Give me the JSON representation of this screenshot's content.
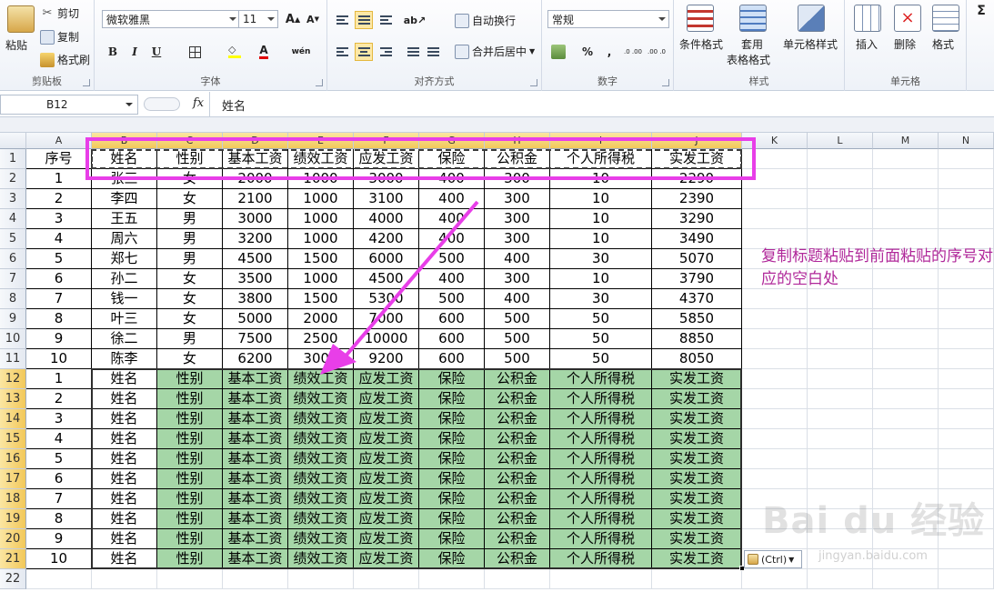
{
  "ribbon": {
    "clipboard": {
      "label": "剪贴板",
      "paste": "粘贴",
      "cut": "剪切",
      "copy": "复制",
      "format_painter": "格式刷"
    },
    "font": {
      "label": "字体",
      "name": "微软雅黑",
      "size": "11",
      "bold": "B",
      "italic": "I",
      "underline": "U",
      "phonetic": "wén"
    },
    "alignment": {
      "label": "对齐方式",
      "wrap_text": "自动换行",
      "merge_center": "合并后居中"
    },
    "number": {
      "label": "数字",
      "format": "常规",
      "percent": "%",
      "comma": ",",
      "inc_decimal": ".0 .00",
      "dec_decimal": ".00 .0"
    },
    "styles": {
      "label": "样式",
      "conditional": "条件格式",
      "format_table_1": "套用",
      "format_table_2": "表格格式",
      "cell_styles": "单元格样式"
    },
    "cells": {
      "label": "单元格",
      "insert": "插入",
      "delete": "删除",
      "format": "格式"
    },
    "editing": {
      "sigma": "Σ"
    }
  },
  "formula_bar": {
    "name_box": "B12",
    "fx": "fx",
    "content": "姓名"
  },
  "columns": [
    {
      "letter": "A"
    },
    {
      "letter": "B"
    },
    {
      "letter": "C"
    },
    {
      "letter": "D"
    },
    {
      "letter": "E"
    },
    {
      "letter": "F"
    },
    {
      "letter": "G"
    },
    {
      "letter": "H"
    },
    {
      "letter": "I"
    },
    {
      "letter": "J"
    },
    {
      "letter": "K"
    },
    {
      "letter": "L"
    },
    {
      "letter": "M"
    },
    {
      "letter": "N"
    }
  ],
  "rows": [
    [
      "1",
      "序号",
      "姓名",
      "性别",
      "基本工资",
      "绩效工资",
      "应发工资",
      "保险",
      "公积金",
      "个人所得税",
      "实发工资"
    ],
    [
      "2",
      "1",
      "张三",
      "女",
      "2000",
      "1000",
      "3000",
      "400",
      "300",
      "10",
      "2290"
    ],
    [
      "3",
      "2",
      "李四",
      "女",
      "2100",
      "1000",
      "3100",
      "400",
      "300",
      "10",
      "2390"
    ],
    [
      "4",
      "3",
      "王五",
      "男",
      "3000",
      "1000",
      "4000",
      "400",
      "300",
      "10",
      "3290"
    ],
    [
      "5",
      "4",
      "周六",
      "男",
      "3200",
      "1000",
      "4200",
      "400",
      "300",
      "10",
      "3490"
    ],
    [
      "6",
      "5",
      "郑七",
      "男",
      "4500",
      "1500",
      "6000",
      "500",
      "400",
      "30",
      "5070"
    ],
    [
      "7",
      "6",
      "孙二",
      "女",
      "3500",
      "1000",
      "4500",
      "400",
      "300",
      "10",
      "3790"
    ],
    [
      "8",
      "7",
      "钱一",
      "女",
      "3800",
      "1500",
      "5300",
      "500",
      "400",
      "30",
      "4370"
    ],
    [
      "9",
      "8",
      "叶三",
      "女",
      "5000",
      "2000",
      "7000",
      "600",
      "500",
      "50",
      "5850"
    ],
    [
      "10",
      "9",
      "徐二",
      "男",
      "7500",
      "2500",
      "10000",
      "600",
      "500",
      "50",
      "8850"
    ],
    [
      "11",
      "10",
      "陈李",
      "女",
      "6200",
      "3000",
      "9200",
      "600",
      "500",
      "50",
      "8050"
    ],
    [
      "12",
      "1",
      "姓名",
      "性别",
      "基本工资",
      "绩效工资",
      "应发工资",
      "保险",
      "公积金",
      "个人所得税",
      "实发工资"
    ],
    [
      "13",
      "2",
      "姓名",
      "性别",
      "基本工资",
      "绩效工资",
      "应发工资",
      "保险",
      "公积金",
      "个人所得税",
      "实发工资"
    ],
    [
      "14",
      "3",
      "姓名",
      "性别",
      "基本工资",
      "绩效工资",
      "应发工资",
      "保险",
      "公积金",
      "个人所得税",
      "实发工资"
    ],
    [
      "15",
      "4",
      "姓名",
      "性别",
      "基本工资",
      "绩效工资",
      "应发工资",
      "保险",
      "公积金",
      "个人所得税",
      "实发工资"
    ],
    [
      "16",
      "5",
      "姓名",
      "性别",
      "基本工资",
      "绩效工资",
      "应发工资",
      "保险",
      "公积金",
      "个人所得税",
      "实发工资"
    ],
    [
      "17",
      "6",
      "姓名",
      "性别",
      "基本工资",
      "绩效工资",
      "应发工资",
      "保险",
      "公积金",
      "个人所得税",
      "实发工资"
    ],
    [
      "18",
      "7",
      "姓名",
      "性别",
      "基本工资",
      "绩效工资",
      "应发工资",
      "保险",
      "公积金",
      "个人所得税",
      "实发工资"
    ],
    [
      "19",
      "8",
      "姓名",
      "性别",
      "基本工资",
      "绩效工资",
      "应发工资",
      "保险",
      "公积金",
      "个人所得税",
      "实发工资"
    ],
    [
      "20",
      "9",
      "姓名",
      "性别",
      "基本工资",
      "绩效工资",
      "应发工资",
      "保险",
      "公积金",
      "个人所得税",
      "实发工资"
    ],
    [
      "21",
      "10",
      "姓名",
      "性别",
      "基本工资",
      "绩效工资",
      "应发工资",
      "保险",
      "公积金",
      "个人所得税",
      "实发工资"
    ],
    [
      "22"
    ]
  ],
  "annotation": {
    "text": "复制标题粘贴到前面粘贴的序号对应的空白处",
    "color": "#b0289a"
  },
  "paste_options": {
    "label": "(Ctrl)"
  },
  "watermark": {
    "text": "Bai du 经验",
    "url": "jingyan.baidu.com"
  },
  "colors": {
    "highlight": "#e83ee8",
    "pasted_fill": "#a5d6a7",
    "selected_header": "#f2c85a"
  }
}
